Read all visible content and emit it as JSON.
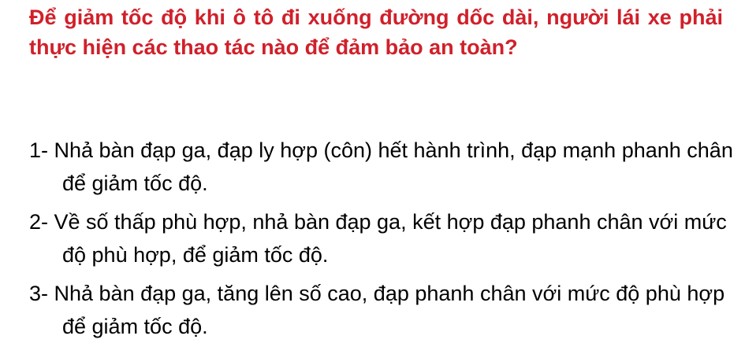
{
  "question": {
    "text": "Để giảm tốc độ khi ô tô đi xuống đường dốc dài, người lái xe phải thực hiện các thao tác nào để đảm bảo an toàn?",
    "color": "#d0202a"
  },
  "answers": [
    {
      "text": "1- Nhả bàn đạp ga, đạp ly hợp (côn) hết hành trình, đạp mạnh phanh chân để giảm tốc độ."
    },
    {
      "text": "2- Về số thấp phù hợp, nhả bàn đạp ga, kết hợp đạp phanh chân với mức độ phù hợp, để giảm tốc độ."
    },
    {
      "text": "3- Nhả bàn đạp ga, tăng lên số cao, đạp phanh chân với mức độ phù hợp để giảm tốc độ."
    }
  ]
}
